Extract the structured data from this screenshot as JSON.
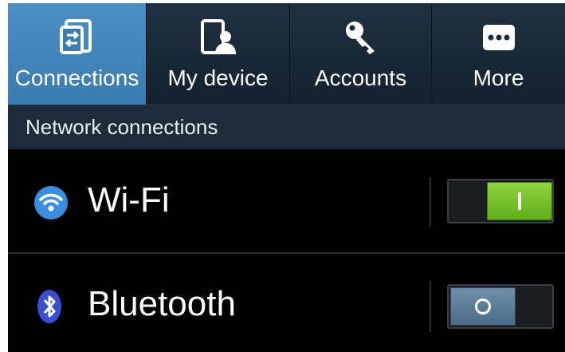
{
  "tabs": [
    {
      "label": "Connections",
      "icon": "connections-icon",
      "active": true
    },
    {
      "label": "My device",
      "icon": "my-device-icon",
      "active": false
    },
    {
      "label": "Accounts",
      "icon": "accounts-icon",
      "active": false
    },
    {
      "label": "More",
      "icon": "more-icon",
      "active": false
    }
  ],
  "section": {
    "title": "Network connections"
  },
  "settings": [
    {
      "label": "Wi-Fi",
      "icon": "wifi-icon",
      "state": "on"
    },
    {
      "label": "Bluetooth",
      "icon": "bluetooth-icon",
      "state": "off"
    }
  ],
  "colors": {
    "active_tab": "#3a7bb0",
    "toggle_on": "#6fbf22",
    "toggle_off": "#4b6c88",
    "background": "#000000"
  }
}
